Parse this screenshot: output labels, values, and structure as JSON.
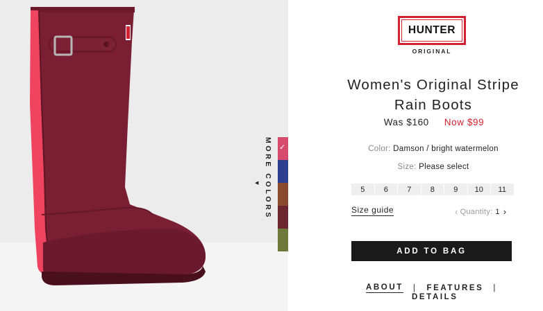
{
  "brand": {
    "logo_text": "HUNTER",
    "logo_sub": "ORIGINAL",
    "brand_color": "#d3212f"
  },
  "product": {
    "title_line1": "Women's Original Stripe",
    "title_line2": "Rain Boots",
    "price_was": "Was $160",
    "price_now": "Now $99",
    "boot_color": "#7a1f33",
    "stripe_color": "#f0435f"
  },
  "color_option": {
    "label": "Color:",
    "value": "Damson / bright watermelon"
  },
  "size_option": {
    "label": "Size:",
    "value": "Please select",
    "sizes": [
      "5",
      "6",
      "7",
      "8",
      "9",
      "10",
      "11"
    ]
  },
  "gallery": {
    "more_colors_label": "MORE COLORS",
    "more_icon": "caret-left-icon",
    "swatches": [
      {
        "name": "damson-watermelon",
        "color": "#d64a6e",
        "selected": true
      },
      {
        "name": "navy-blue",
        "color": "#2e3f8f",
        "selected": false
      },
      {
        "name": "brown",
        "color": "#8a4a2e",
        "selected": false
      },
      {
        "name": "dark-red",
        "color": "#6b2630",
        "selected": false
      },
      {
        "name": "olive-green",
        "color": "#6f7a3a",
        "selected": false
      }
    ]
  },
  "size_guide_label": "Size guide",
  "quantity": {
    "label": "Quantity:",
    "value": "1"
  },
  "add_to_bag_label": "ADD TO BAG",
  "tabs": {
    "about": "ABOUT",
    "separator": "|",
    "features": "FEATURES",
    "details": "DETAILS"
  }
}
